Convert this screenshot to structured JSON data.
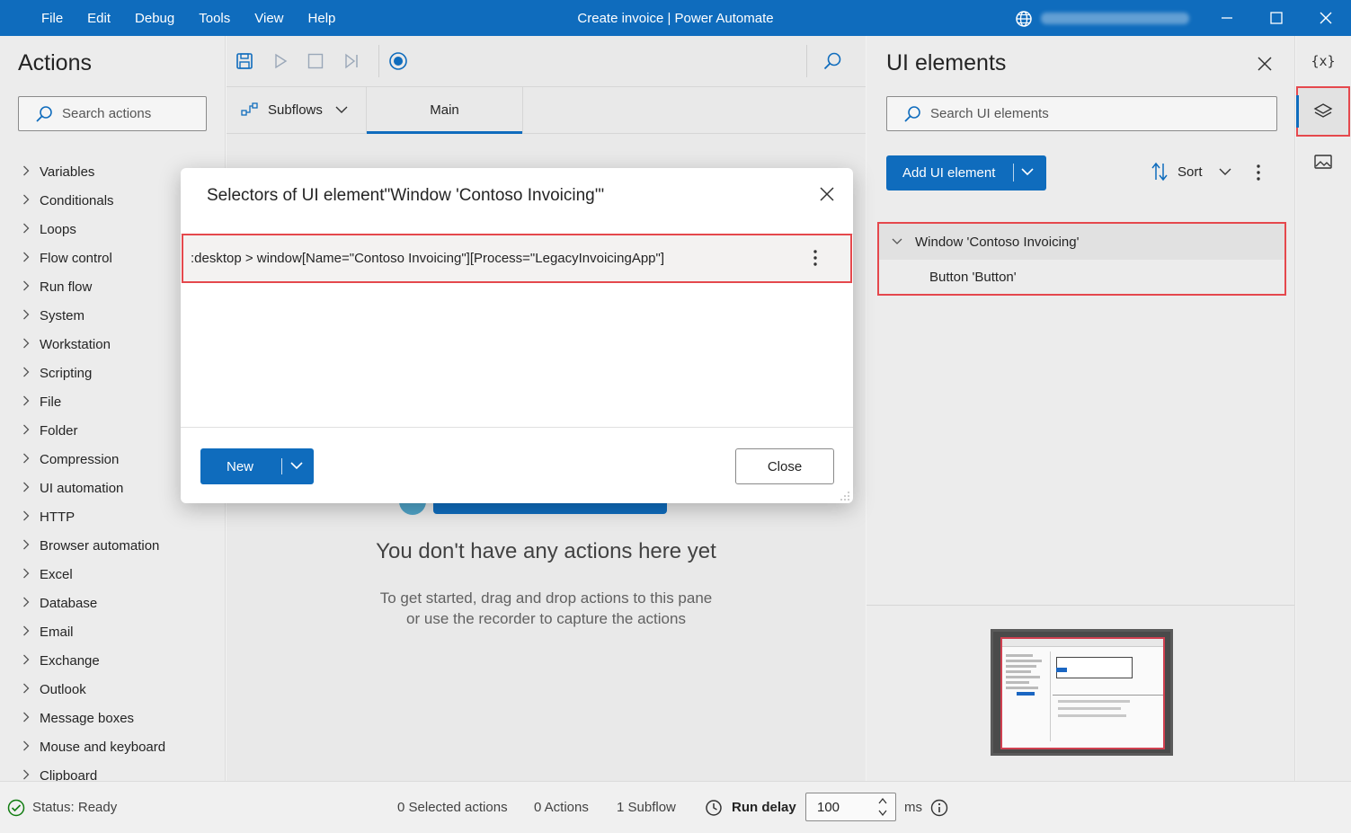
{
  "titlebar": {
    "menu": [
      "File",
      "Edit",
      "Debug",
      "Tools",
      "View",
      "Help"
    ],
    "title": "Create invoice | Power Automate"
  },
  "actions": {
    "title": "Actions",
    "search_placeholder": "Search actions",
    "categories": [
      "Variables",
      "Conditionals",
      "Loops",
      "Flow control",
      "Run flow",
      "System",
      "Workstation",
      "Scripting",
      "File",
      "Folder",
      "Compression",
      "UI automation",
      "HTTP",
      "Browser automation",
      "Excel",
      "Database",
      "Email",
      "Exchange",
      "Outlook",
      "Message boxes",
      "Mouse and keyboard",
      "Clipboard"
    ]
  },
  "designer": {
    "subflows_label": "Subflows",
    "main_tab": "Main",
    "empty_title": "You don't have any actions here yet",
    "empty_line1": "To get started, drag and drop actions to this pane",
    "empty_line2": "or use the recorder to capture the actions"
  },
  "ui_elements": {
    "title": "UI elements",
    "search_placeholder": "Search UI elements",
    "add_button": "Add UI element",
    "sort_label": "Sort",
    "tree": {
      "window": "Window 'Contoso Invoicing'",
      "child": "Button 'Button'"
    }
  },
  "rail": {
    "variables_glyph": "{x}"
  },
  "dialog": {
    "title": "Selectors of UI element\"Window 'Contoso Invoicing'\"",
    "selector": ":desktop > window[Name=\"Contoso Invoicing\"][Process=\"LegacyInvoicingApp\"]",
    "new_button": "New",
    "close_button": "Close"
  },
  "statusbar": {
    "status": "Status: Ready",
    "selected_actions": "0 Selected actions",
    "actions_count": "0 Actions",
    "subflows_count": "1 Subflow",
    "run_delay_label": "Run delay",
    "run_delay_value": "100",
    "unit": "ms"
  },
  "colors": {
    "accent": "#0f6cbd",
    "highlight": "#e5484d"
  }
}
